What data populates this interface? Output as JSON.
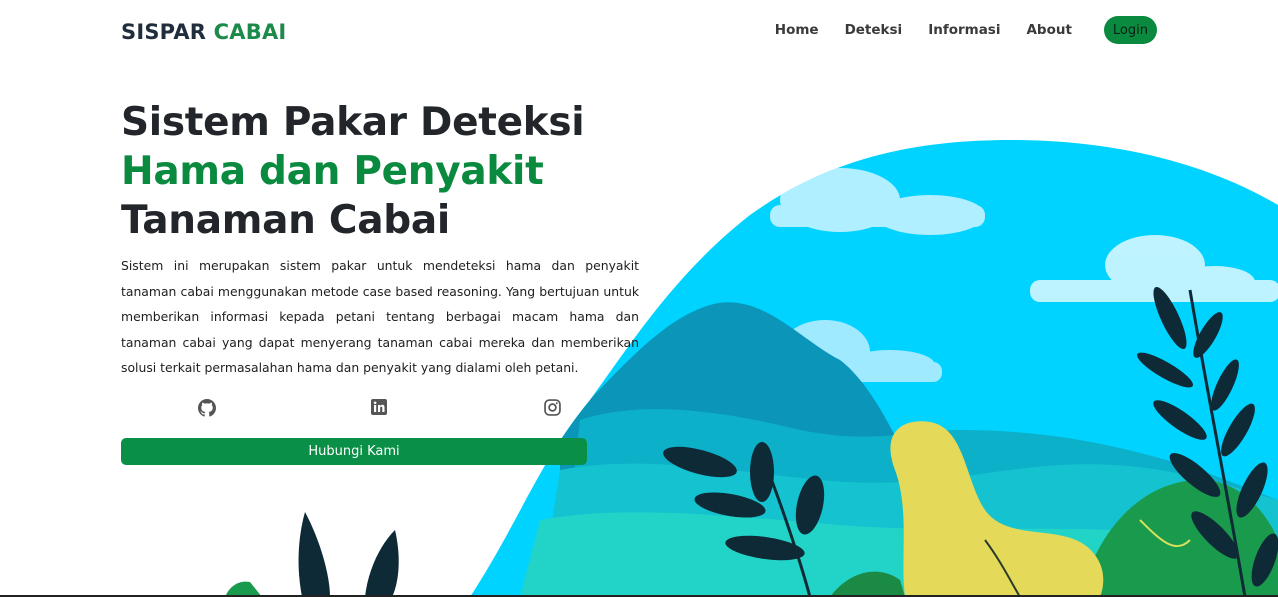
{
  "navbar": {
    "brand_part1": "SISPAR",
    "brand_part2": "CABAI",
    "links": [
      "Home",
      "Deteksi",
      "Informasi",
      "About"
    ],
    "login_label": "Login"
  },
  "hero": {
    "title_line1": "Sistem Pakar Deteksi",
    "title_line2": "Hama dan Penyakit",
    "title_line3": "Tanaman Cabai",
    "description": "Sistem ini merupakan sistem pakar untuk mendeteksi hama dan penyakit tanaman cabai menggunakan metode case based reasoning. Yang bertujuan untuk memberikan informasi kepada petani tentang berbagai macam hama dan tanaman cabai yang dapat menyerang tanaman cabai mereka dan memberikan solusi terkait permasalahan hama dan penyakit yang dialami oleh petani.",
    "contact_label": "Hubungi Kami"
  },
  "socials": [
    "github-icon",
    "linkedin-icon",
    "instagram-icon"
  ],
  "colors": {
    "brand_green": "#0a8a3f",
    "sky": "#00d3ff",
    "mountain": "#0aa5c6",
    "dark_leaf": "#0e2a36",
    "yellow_plant": "#e5d95a"
  }
}
